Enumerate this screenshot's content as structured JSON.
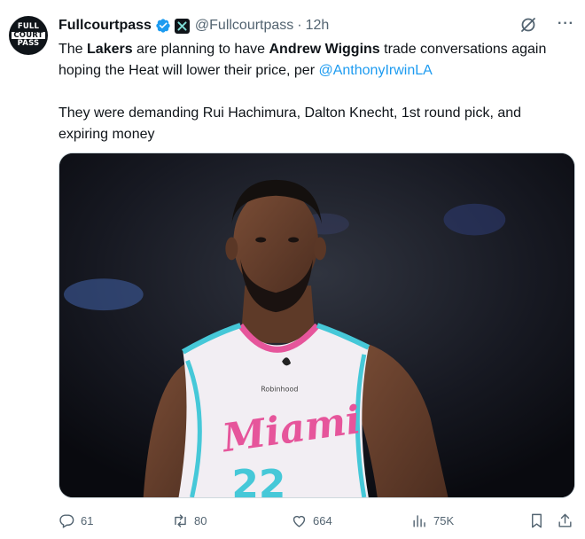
{
  "avatar": {
    "line1": "FULL",
    "line2": "COURT",
    "line3": "PASS"
  },
  "author": {
    "name": "Fullcourtpass",
    "handle": "@Fullcourtpass",
    "separator": "·",
    "time": "12h"
  },
  "tweet": {
    "p1_a": "The ",
    "p1_b": "Lakers",
    "p1_c": " are planning to have ",
    "p1_d": "Andrew Wiggins",
    "p1_e": " trade conversations again hoping the Heat will lower their price, per ",
    "p1_mention": "@AnthonyIrwinLA",
    "p2": "They were demanding Rui Hachimura, Dalton Knecht, 1st round pick, and expiring money"
  },
  "media": {
    "jersey_text": "Miami",
    "sponsor_text": "Robinhood",
    "number": "22"
  },
  "actions": {
    "replies": "61",
    "reposts": "80",
    "likes": "664",
    "views": "75K"
  },
  "colors": {
    "link": "#1d9bf0",
    "verified": "#1d9bf0",
    "muted": "#536471",
    "text": "#0f1419"
  }
}
